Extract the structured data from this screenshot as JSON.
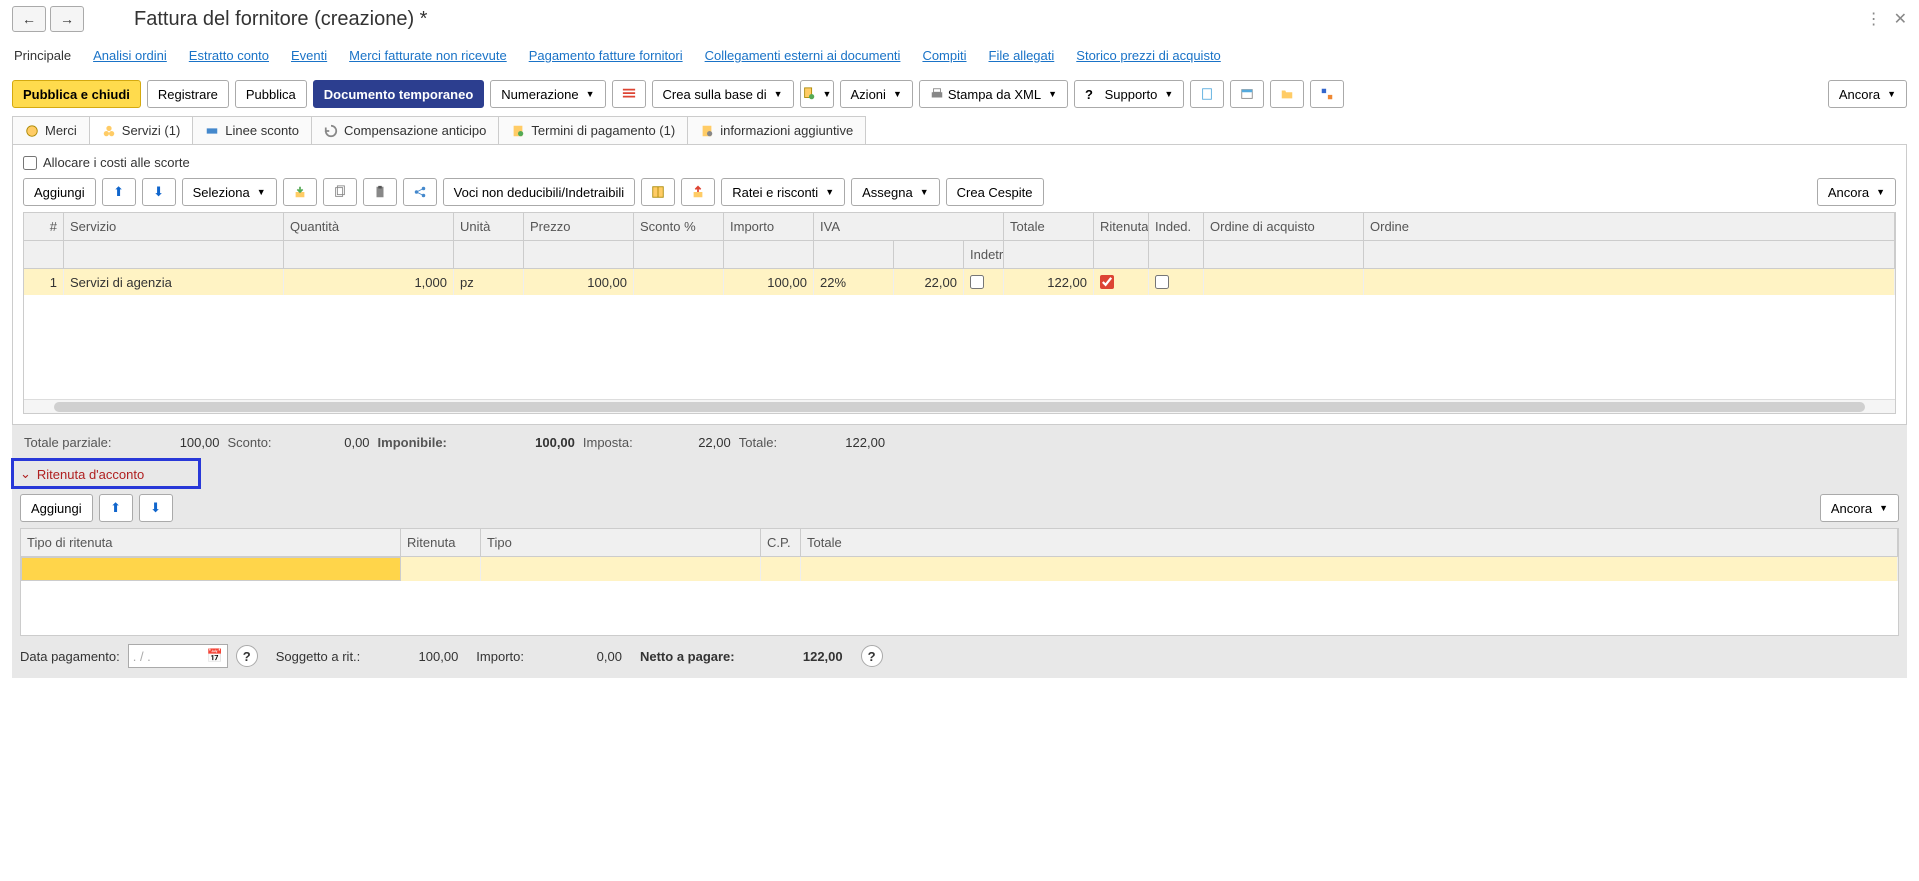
{
  "title": "Fattura del fornitore (creazione) *",
  "nav_tabs": {
    "principale": "Principale",
    "analisi": "Analisi ordini",
    "estratto": "Estratto conto",
    "eventi": "Eventi",
    "merci": "Merci fatturate non ricevute",
    "pagamento": "Pagamento fatture fornitori",
    "collegamenti": "Collegamenti esterni ai documenti",
    "compiti": "Compiti",
    "file": "File allegati",
    "storico": "Storico prezzi di acquisto"
  },
  "toolbar": {
    "pubblica_chiudi": "Pubblica e chiudi",
    "registrare": "Registrare",
    "pubblica": "Pubblica",
    "doc_temp": "Documento temporaneo",
    "numerazione": "Numerazione",
    "crea_base": "Crea sulla base di",
    "azioni": "Azioni",
    "stampa_xml": "Stampa da XML",
    "supporto": "Supporto",
    "ancora": "Ancora"
  },
  "sub_tabs": {
    "merci": "Merci",
    "servizi": "Servizi (1)",
    "linee": "Linee sconto",
    "compensazione": "Compensazione anticipo",
    "termini": "Termini di pagamento (1)",
    "info": "informazioni aggiuntive"
  },
  "allocare": "Allocare i costi alle scorte",
  "inner_toolbar": {
    "aggiungi": "Aggiungi",
    "seleziona": "Seleziona",
    "voci": "Voci non deducibili/Indetraibili",
    "ratei": "Ratei e risconti",
    "assegna": "Assegna",
    "crea_cespite": "Crea Cespite",
    "ancora": "Ancora"
  },
  "grid_headers": {
    "num": "#",
    "servizio": "Servizio",
    "quantita": "Quantità",
    "unita": "Unità",
    "prezzo": "Prezzo",
    "sconto": "Sconto %",
    "importo": "Importo",
    "iva": "IVA",
    "indetr": "Indetr",
    "totale": "Totale",
    "ritenuta": "Ritenuta",
    "inded": "Inded.",
    "ordine_acq": "Ordine di acquisto",
    "ordine": "Ordine"
  },
  "grid_row": {
    "num": "1",
    "servizio": "Servizi di agenzia",
    "quantita": "1,000",
    "unita": "pz",
    "prezzo": "100,00",
    "sconto": "",
    "importo": "100,00",
    "iva": "22%",
    "iva_val": "22,00",
    "totale": "122,00"
  },
  "totals": {
    "parziale_lbl": "Totale parziale:",
    "parziale_val": "100,00",
    "sconto_lbl": "Sconto:",
    "sconto_val": "0,00",
    "imponibile_lbl": "Imponibile:",
    "imponibile_val": "100,00",
    "imposta_lbl": "Imposta:",
    "imposta_val": "22,00",
    "totale_lbl": "Totale:",
    "totale_val": "122,00"
  },
  "section": {
    "ritenuta": "Ritenuta d'acconto"
  },
  "footer_toolbar": {
    "aggiungi": "Aggiungi",
    "ancora": "Ancora"
  },
  "footer_headers": {
    "tipo_rit": "Tipo di ritenuta",
    "ritenuta": "Ritenuta",
    "tipo": "Tipo",
    "cp": "C.P.",
    "totale": "Totale"
  },
  "footer_bar": {
    "data_pag": "Data pagamento:",
    "data_val": ". / .",
    "soggetto": "Soggetto a rit.:",
    "soggetto_val": "100,00",
    "importo": "Importo:",
    "importo_val": "0,00",
    "netto": "Netto a pagare:",
    "netto_val": "122,00"
  }
}
